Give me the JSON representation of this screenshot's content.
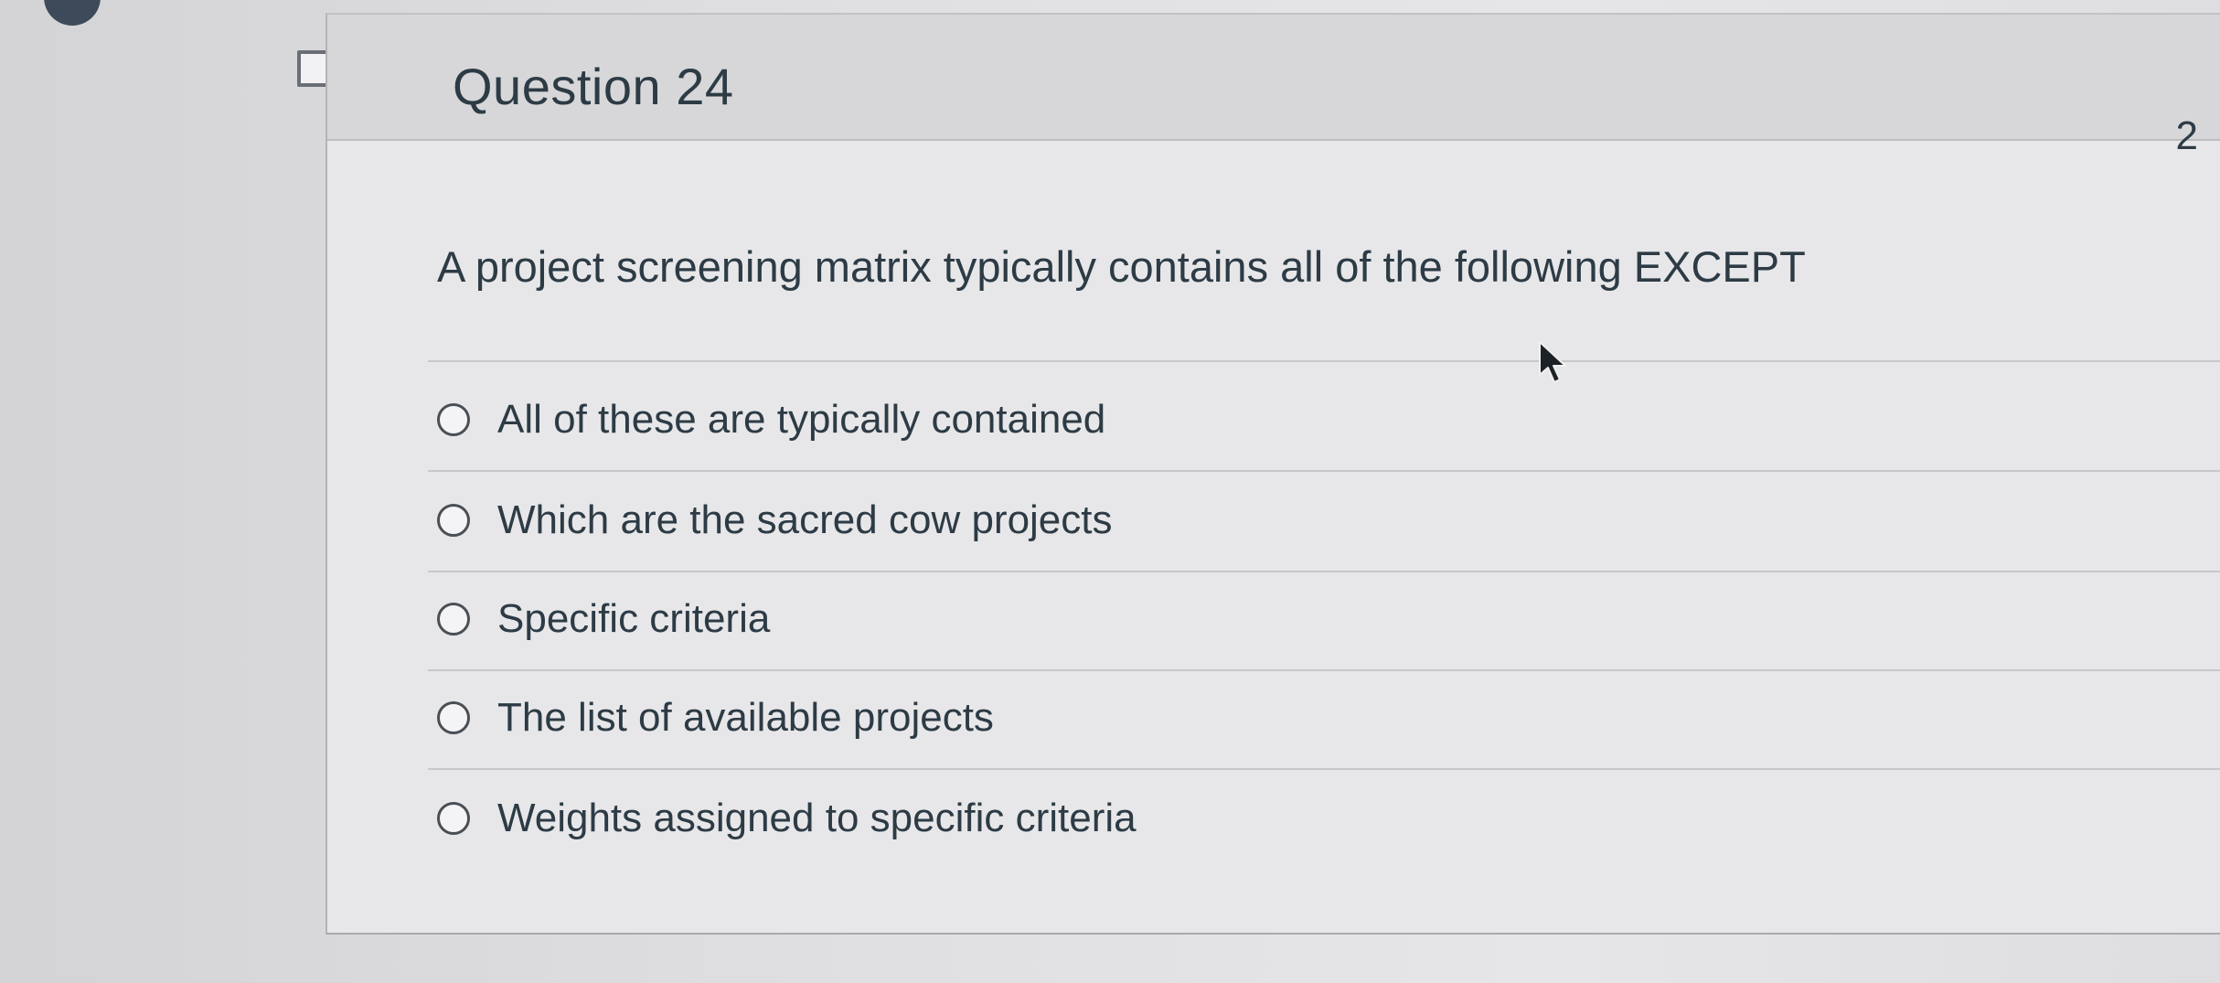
{
  "question": {
    "title": "Question 24",
    "points": "2",
    "text": "A project screening matrix typically contains all of the following EXCEPT"
  },
  "answers": [
    {
      "label": "All of these are typically contained"
    },
    {
      "label": "Which are the sacred cow projects"
    },
    {
      "label": "Specific criteria"
    },
    {
      "label": "The list of available projects"
    },
    {
      "label": "Weights assigned to specific criteria"
    }
  ],
  "icons": {
    "flag": "flag-outline-icon",
    "radio": "radio-unchecked-icon",
    "cursor": "mouse-pointer-icon"
  },
  "colors": {
    "text": "#2d3b45",
    "header_bg": "#d7d7d9",
    "card_bg": "#e7e7e9"
  }
}
